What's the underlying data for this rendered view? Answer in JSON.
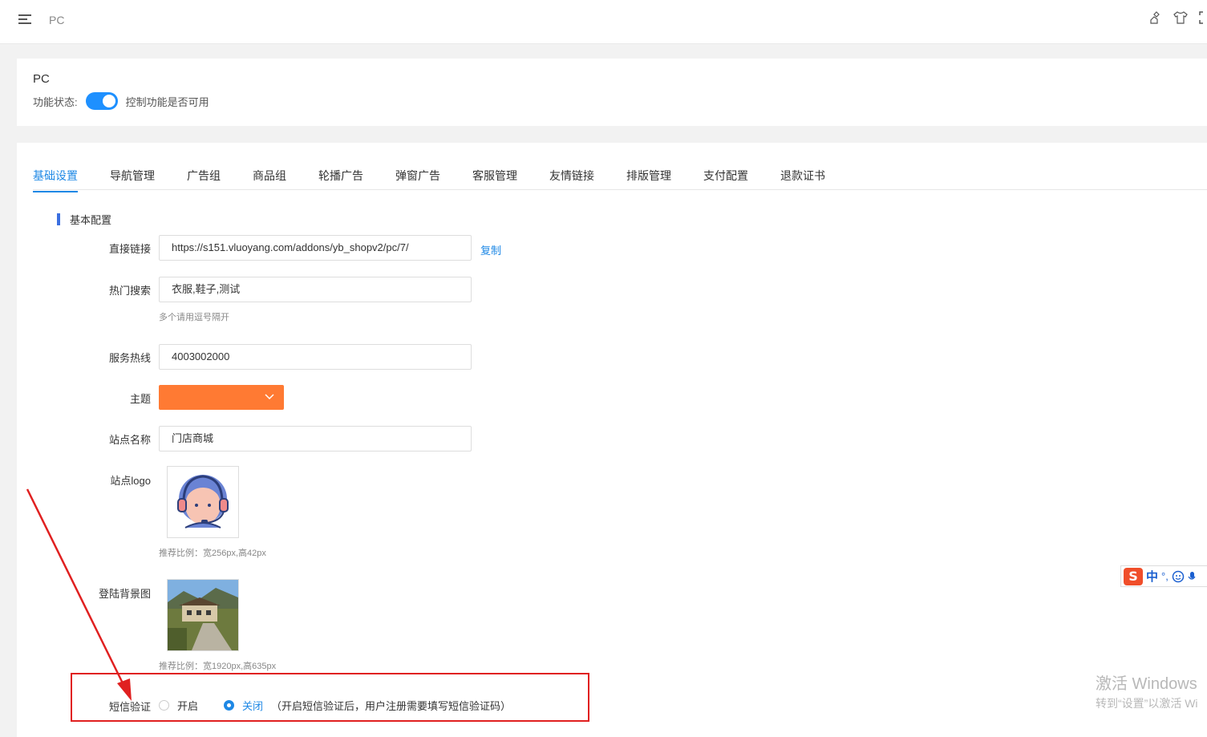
{
  "topbar": {
    "title": "PC",
    "icons": [
      "menu-icon",
      "broom-icon",
      "shirt-icon",
      "fullscreen-icon"
    ]
  },
  "module": {
    "title": "PC",
    "status_label": "功能状态:",
    "status_on": true,
    "status_desc": "控制功能是否可用"
  },
  "tabs": [
    {
      "label": "基础设置",
      "active": true
    },
    {
      "label": "导航管理"
    },
    {
      "label": "广告组"
    },
    {
      "label": "商品组"
    },
    {
      "label": "轮播广告"
    },
    {
      "label": "弹窗广告"
    },
    {
      "label": "客服管理"
    },
    {
      "label": "友情链接"
    },
    {
      "label": "排版管理"
    },
    {
      "label": "支付配置"
    },
    {
      "label": "退款证书"
    }
  ],
  "section": {
    "title": "基本配置"
  },
  "form": {
    "direct_link": {
      "label": "直接链接",
      "value": "https://s151.vluoyang.com/addons/yb_shopv2/pc/7/",
      "copy": "复制"
    },
    "hot_search": {
      "label": "热门搜索",
      "value": "衣服,鞋子,测试",
      "hint": "多个请用逗号隔开"
    },
    "hotline": {
      "label": "服务热线",
      "value": "4003002000"
    },
    "theme": {
      "label": "主题",
      "color": "#ff7a33"
    },
    "site_name": {
      "label": "站点名称",
      "value": "门店商城"
    },
    "site_logo": {
      "label": "站点logo",
      "hint": "推荐比例：宽256px,高42px"
    },
    "login_bg": {
      "label": "登陆背景图",
      "hint": "推荐比例：宽1920px,高635px"
    },
    "sms_verify": {
      "label": "短信验证",
      "option_on": "开启",
      "option_off": "关闭",
      "selected": "关闭",
      "note": "（开启短信验证后，用户注册需要填写短信验证码）"
    }
  },
  "ime": {
    "logo": "S",
    "mode": "中",
    "punct": "°,"
  },
  "watermark": {
    "line1": "激活 Windows",
    "line2": "转到“设置”以激活 Wi"
  },
  "colors": {
    "accent": "#1e88e5",
    "annotation_red": "#e02020",
    "theme_orange": "#ff7a33"
  }
}
